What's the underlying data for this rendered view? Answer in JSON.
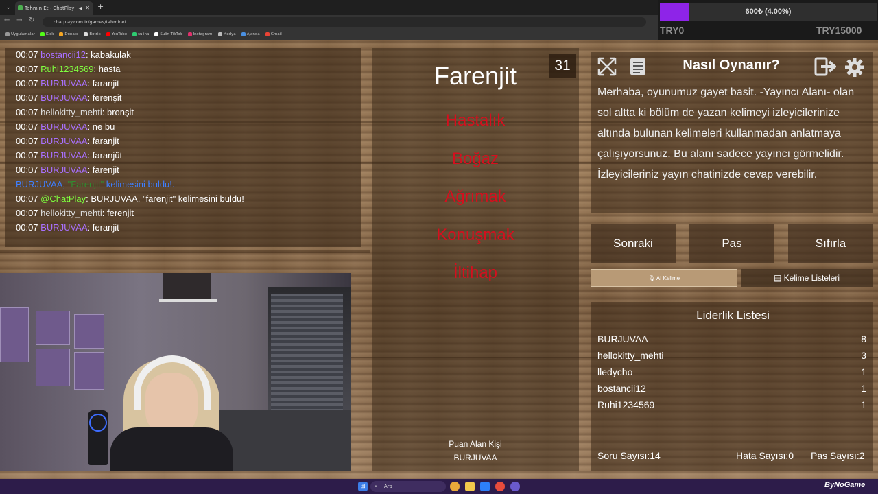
{
  "browser": {
    "tab_title": "Tahmin Et - ChatPlay",
    "new_tab": "+",
    "url": "chatplay.com.tr/games/tahminet",
    "bookmarks": [
      {
        "label": "Uygulamalar",
        "color": "#999999"
      },
      {
        "label": "Kick",
        "color": "#53fc18"
      },
      {
        "label": "Donate",
        "color": "#f5a623"
      },
      {
        "label": "Botrix",
        "color": "#dddddd"
      },
      {
        "label": "YouTube",
        "color": "#ff0000"
      },
      {
        "label": "sulina",
        "color": "#2ecc71"
      },
      {
        "label": "Sulin TikTok",
        "color": "#ffffff"
      },
      {
        "label": "Instagram",
        "color": "#e1306c"
      },
      {
        "label": "Medya",
        "color": "#bbbbbb"
      },
      {
        "label": "Ajanda",
        "color": "#4a90e2"
      },
      {
        "label": "Gmail",
        "color": "#ea4335"
      }
    ]
  },
  "donation": {
    "progress_text": "600₺ (4.00%)",
    "min_label": "TRY0",
    "max_label": "TRY15000",
    "progress_fraction": 0.04,
    "fill_color": "#8e24e8"
  },
  "chat": {
    "messages": [
      {
        "time": "00:07",
        "user": "bostancii12",
        "user_color": "#a970ff",
        "text": "kabakulak"
      },
      {
        "time": "00:07",
        "user": "Ruhi1234569",
        "user_color": "#7fff3f",
        "text": "hasta"
      },
      {
        "time": "00:07",
        "user": "BURJUVAA",
        "user_color": "#a970ff",
        "text": "faranjit"
      },
      {
        "time": "00:07",
        "user": "BURJUVAA",
        "user_color": "#a970ff",
        "text": "ferenşit"
      },
      {
        "time": "00:07",
        "user": "hellokitty_mehti",
        "user_color": "#dddddd",
        "text": "bronşit"
      },
      {
        "time": "00:07",
        "user": "BURJUVAA",
        "user_color": "#a970ff",
        "text": "ne bu"
      },
      {
        "time": "00:07",
        "user": "BURJUVAA",
        "user_color": "#a970ff",
        "text": "faranjit"
      },
      {
        "time": "00:07",
        "user": "BURJUVAA",
        "user_color": "#a970ff",
        "text": "faranjüt"
      },
      {
        "time": "00:07",
        "user": "BURJUVAA",
        "user_color": "#a970ff",
        "text": "farenjit"
      },
      {
        "system": true,
        "pre": "BURJUVAA, ",
        "quote": "\"Farenjit\"",
        "post": " kelimesini buldu!."
      },
      {
        "time": "00:07",
        "user": "@ChatPlay",
        "user_color": "#7fff3f",
        "text": "BURJUVAA, \"farenjit\" kelimesini buldu!"
      },
      {
        "time": "00:07",
        "user": "hellokitty_mehti",
        "user_color": "#dddddd",
        "text": "ferenjit"
      },
      {
        "time": "00:07",
        "user": "BURJUVAA",
        "user_color": "#a970ff",
        "text": "feranjit"
      }
    ]
  },
  "game": {
    "timer": "31",
    "word": "Farenjit",
    "banned_words": [
      "Hastalık",
      "Boğaz",
      "Ağrımak",
      "Konuşmak",
      "İltihap"
    ],
    "scorer_label": "Puan Alan Kişi",
    "scorer_name": "BURJUVAA"
  },
  "howto": {
    "title": "Nasıl Oynanır?",
    "text": "Merhaba, oyunumuz gayet basit. -Yayıncı Alanı- olan sol altta ki bölüm de yazan kelimeyi izleyicilerinize altında bulunan kelimeleri kullanmadan anlatmaya çalışıyorsunuz. Bu alanı sadece yayıncı görmelidir. İzleyicileriniz yayın chatinizde cevap verebilir."
  },
  "controls": {
    "next": "Sonraki",
    "pass": "Pas",
    "reset": "Sıfırla",
    "ai_words": "AI Kelime",
    "word_lists": "Kelime Listeleri"
  },
  "leaderboard": {
    "title": "Liderlik Listesi",
    "rows": [
      {
        "name": "BURJUVAA",
        "score": "8"
      },
      {
        "name": "hellokitty_mehti",
        "score": "3"
      },
      {
        "name": "lledycho",
        "score": "1"
      },
      {
        "name": "bostancii12",
        "score": "1"
      },
      {
        "name": "Ruhi1234569",
        "score": "1"
      }
    ],
    "question_count": "Soru Sayısı:14",
    "error_count": "Hata Sayısı:0",
    "pass_count": "Pas Sayısı:2"
  },
  "taskbar": {
    "search_placeholder": "Ara",
    "brand": "ByNoGame"
  }
}
